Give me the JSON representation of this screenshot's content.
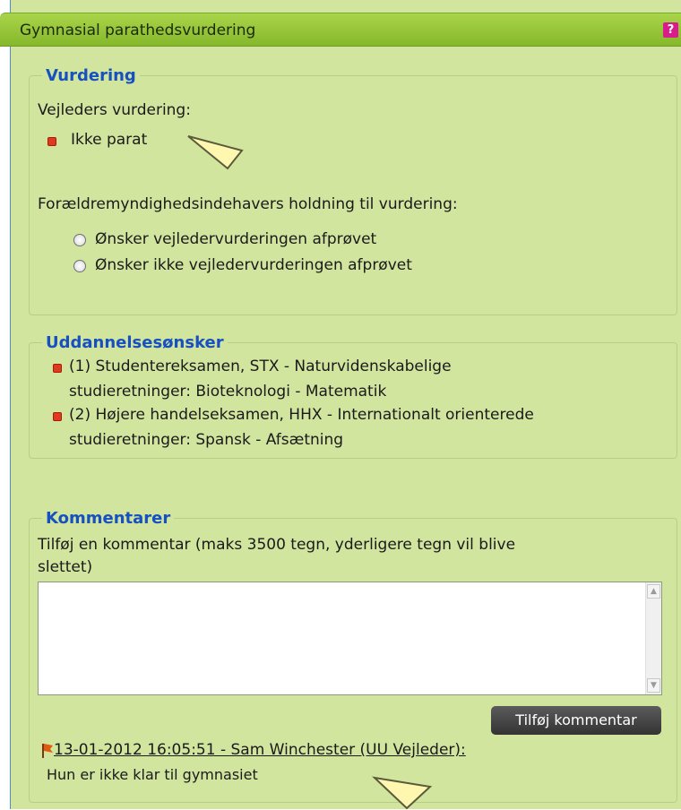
{
  "panel": {
    "title": "Gymnasial parathedsvurdering",
    "help_glyph": "?"
  },
  "vurdering": {
    "legend": "Vurdering",
    "advisor_label": "Vejleders vurdering:",
    "advisor_value": "Ikke parat",
    "parent_label": "Forældremyndighedsindehavers holdning til vurdering:",
    "options": [
      "Ønsker vejledervurderingen afprøvet",
      "Ønsker ikke vejledervurderingen afprøvet"
    ]
  },
  "uddannelse": {
    "legend": "Uddannelsesønsker",
    "items": [
      {
        "line1": "(1) Studentereksamen, STX - Naturvidenskabelige",
        "line2": "studieretninger: Bioteknologi - Matematik"
      },
      {
        "line1": "(2) Højere handelseksamen, HHX - Internationalt orienterede",
        "line2": "studieretninger: Spansk - Afsætning"
      }
    ]
  },
  "kommentarer": {
    "legend": "Kommentarer",
    "instruction_line1": "Tilføj en kommentar (maks 3500 tegn, yderligere tegn vil blive",
    "instruction_line2": "slettet)",
    "textarea_value": "",
    "add_button": "Tilføj kommentar",
    "entries": [
      {
        "header": "13-01-2012 16:05:51 - Sam Winchester (UU Vejleder):",
        "text": "Hun er ikke klar til gymnasiet"
      }
    ]
  },
  "colors": {
    "panel_bg": "#d2e59f",
    "titlebar": "#96c83a",
    "legend_blue": "#1750c0",
    "bullet_red": "#e03a1e",
    "help_pink": "#d81c8c"
  },
  "icons": [
    "help-icon",
    "bullet-icon",
    "radio-icon",
    "pointer-icon",
    "flag-icon",
    "scroll-up-icon",
    "scroll-down-icon"
  ]
}
